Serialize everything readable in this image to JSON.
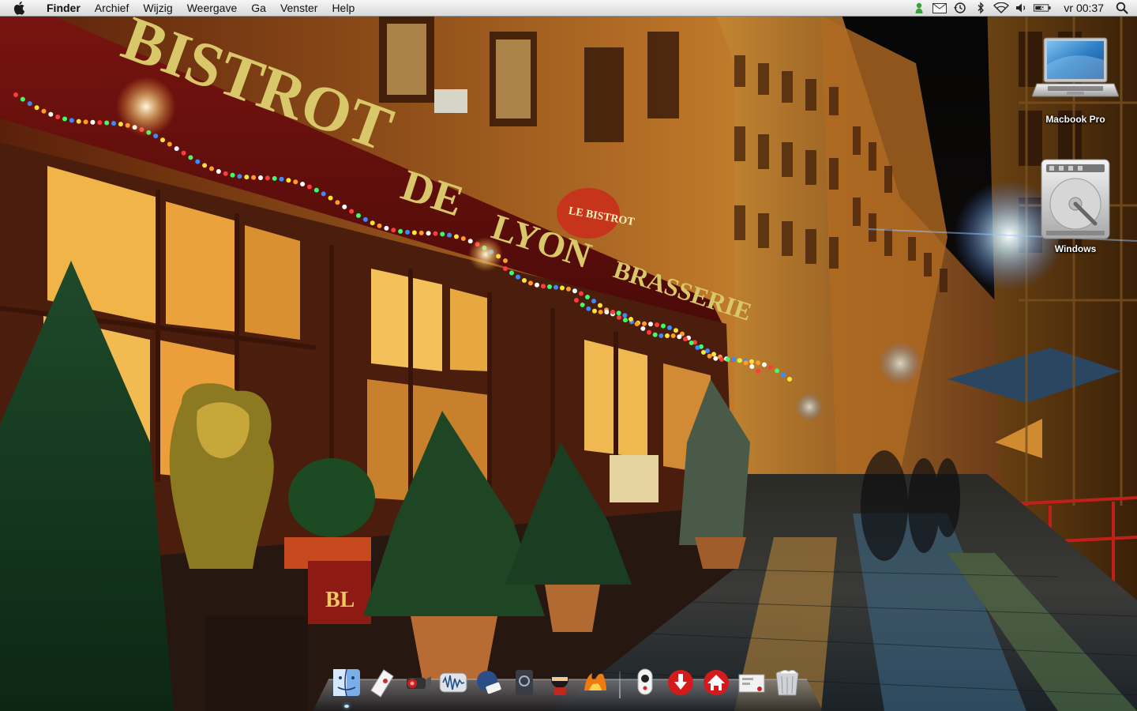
{
  "menubar": {
    "app_name": "Finder",
    "menus": [
      "Archief",
      "Wijzig",
      "Weergave",
      "Ga",
      "Venster",
      "Help"
    ],
    "status_icons": [
      "growl-icon",
      "mail-icon",
      "time-machine-icon",
      "bluetooth-icon",
      "wifi-icon",
      "volume-icon",
      "battery-icon"
    ],
    "clock": "vr 00:37",
    "spotlight_icon": "spotlight-icon"
  },
  "desktop": {
    "icons": [
      {
        "label": "Macbook Pro",
        "icon": "laptop-icon"
      },
      {
        "label": "Windows",
        "icon": "hard-drive-icon"
      }
    ]
  },
  "wallpaper": {
    "signs": [
      "BISTROT",
      "DE",
      "LYON",
      "BRASSERIE",
      "LE BISTROT",
      "BL"
    ]
  },
  "dock": {
    "items": [
      {
        "icon": "finder-icon",
        "running": true
      },
      {
        "icon": "mail-stamp-icon",
        "running": false
      },
      {
        "icon": "video-camera-icon",
        "running": false
      },
      {
        "icon": "audio-wave-icon",
        "running": false
      },
      {
        "icon": "ipod-icon",
        "running": false
      },
      {
        "icon": "app-icon",
        "running": false
      },
      {
        "icon": "ninja-icon",
        "running": false
      },
      {
        "icon": "fire-app-icon",
        "running": false
      },
      {
        "icon": "webcam-icon",
        "running": false
      },
      {
        "icon": "download-icon",
        "running": false
      },
      {
        "icon": "home-icon",
        "running": false
      },
      {
        "icon": "envelope-icon",
        "running": false
      },
      {
        "icon": "trash-icon",
        "running": false
      }
    ]
  }
}
